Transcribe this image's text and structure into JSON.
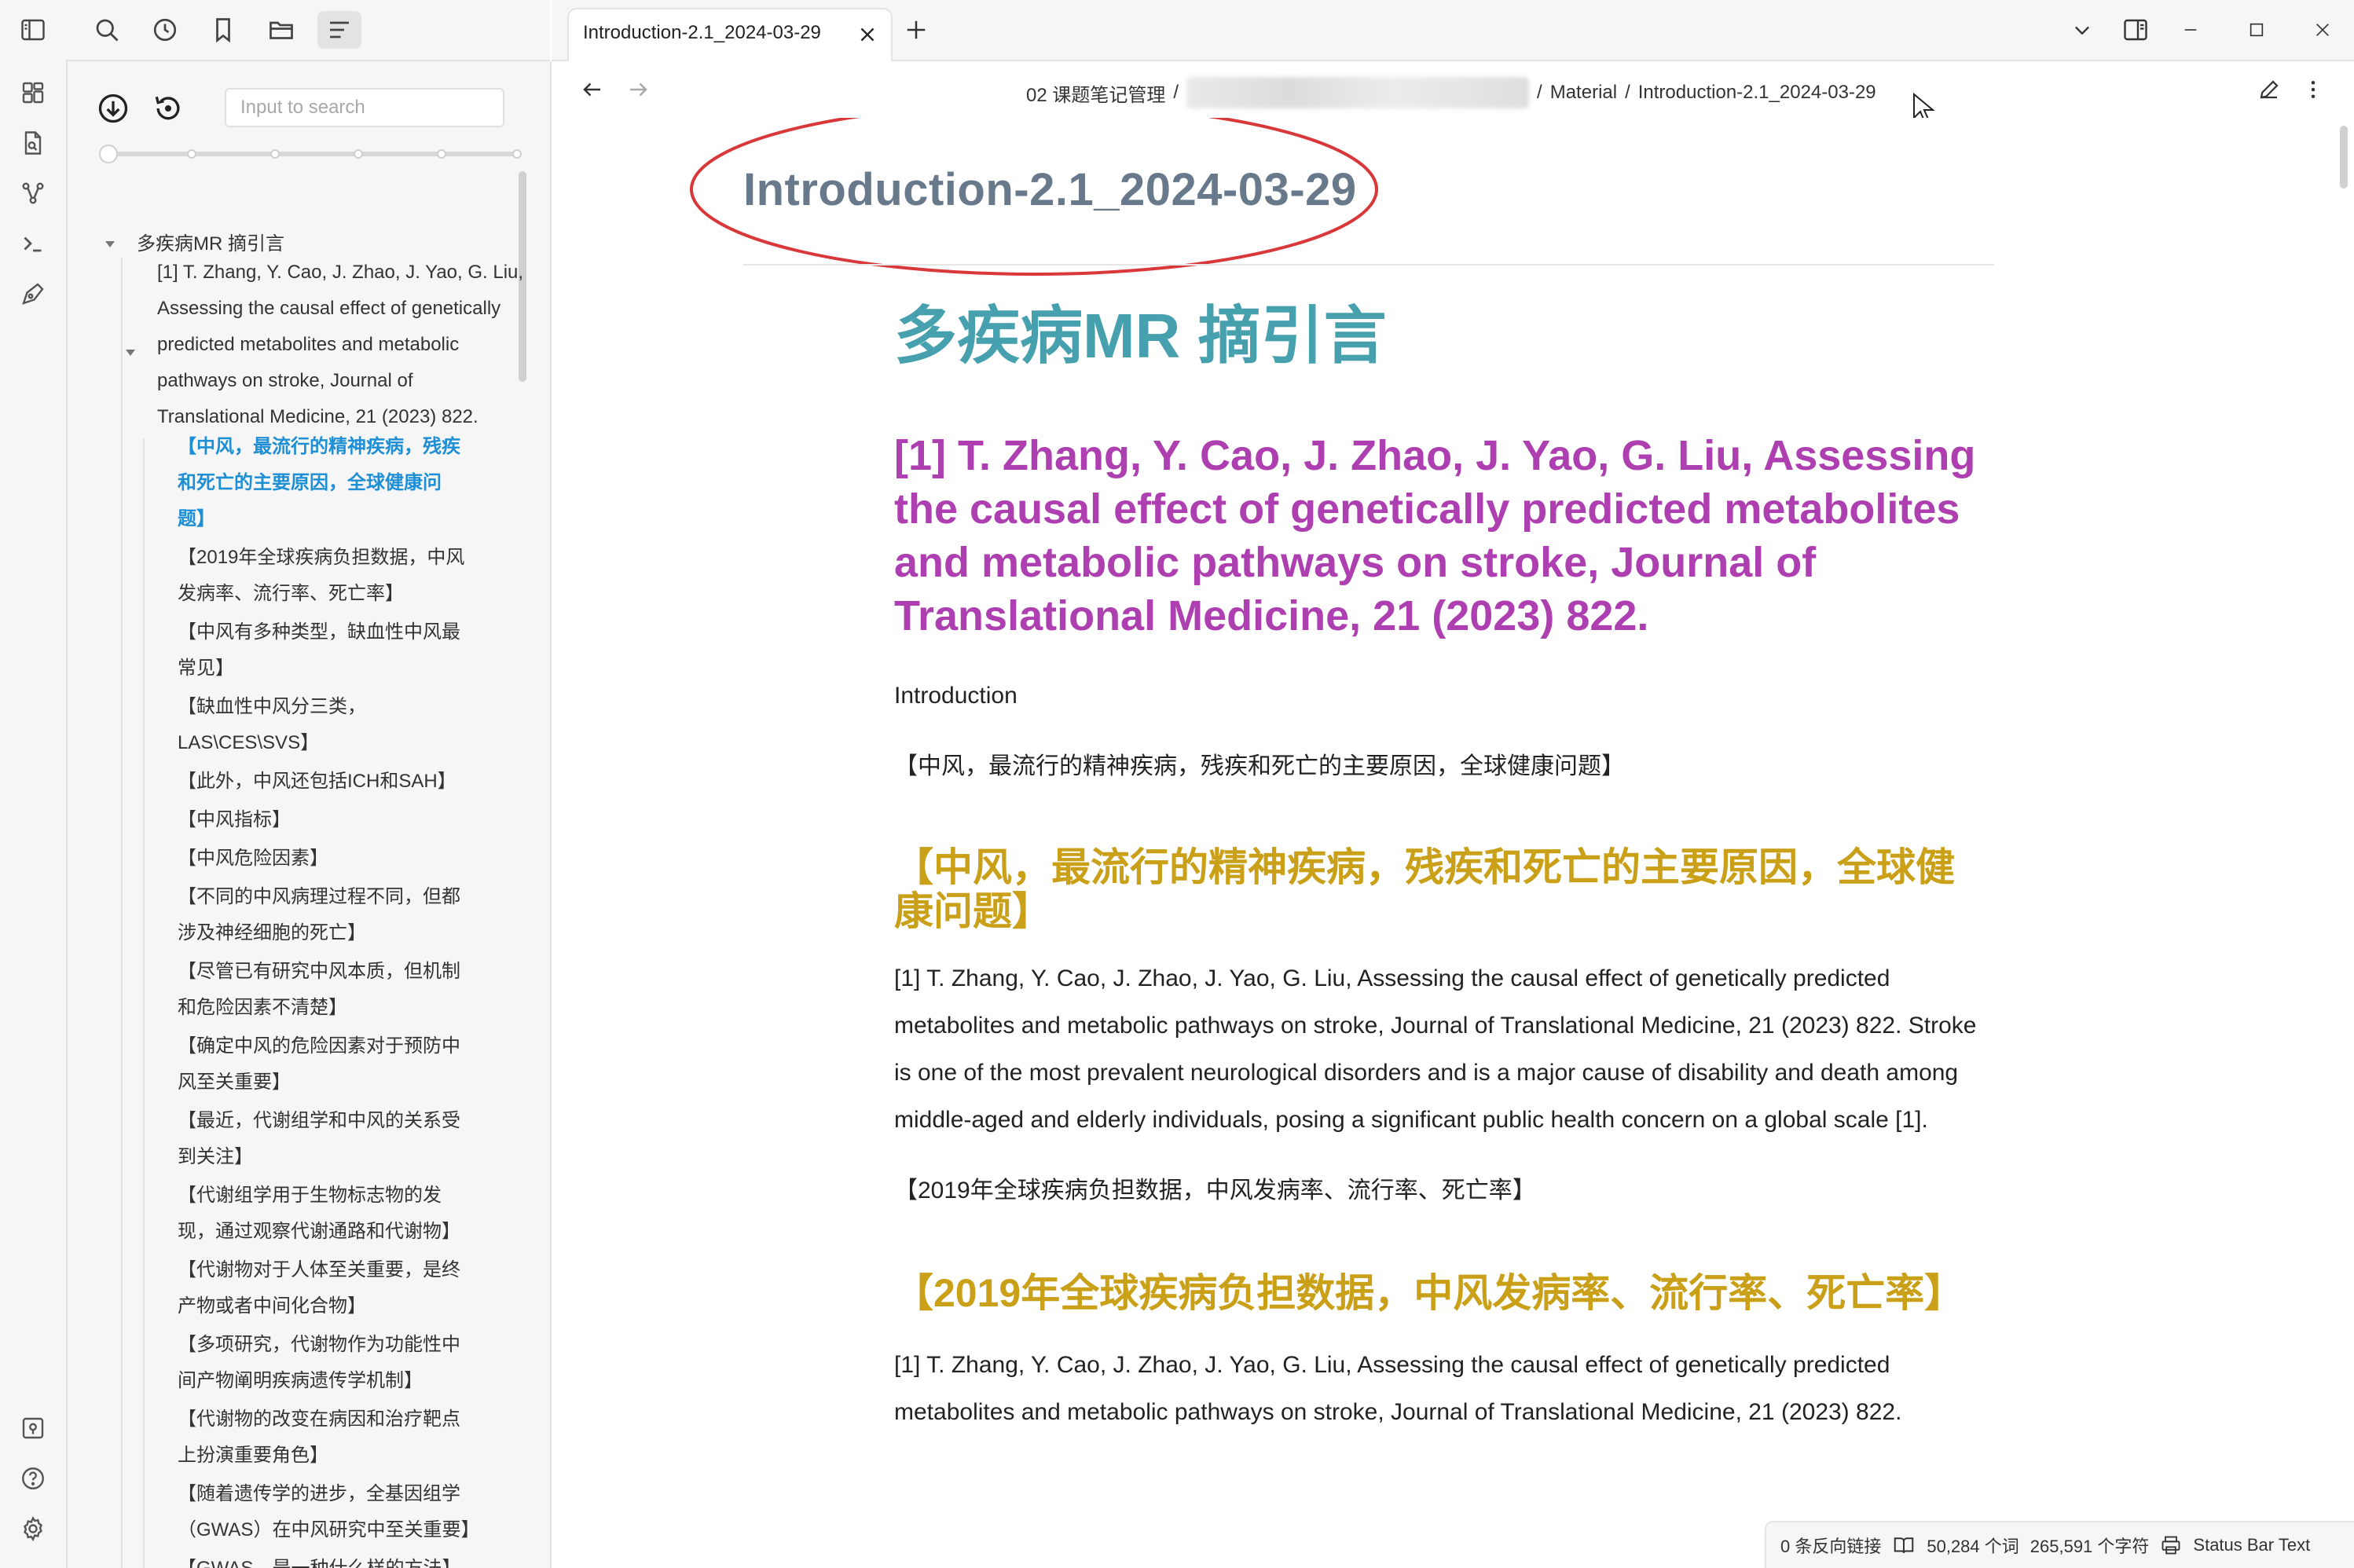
{
  "sidebar": {
    "search_placeholder": "Input to search",
    "outline": {
      "h1": "多疾病MR 摘引言",
      "h2": "[1] T. Zhang, Y. Cao, J. Zhao, J. Yao, G. Liu, Assessing the causal effect of genetically predicted metabolites and metabolic pathways on stroke, Journal of Translational Medicine, 21 (2023) 822.",
      "h2_lines": [
        "[1] T. Zhang, Y. Cao, J. Zhao, J. Yao, G. Liu,",
        "Assessing the causal effect of genetically",
        "predicted metabolites and metabolic",
        "pathways on stroke, Journal of",
        "Translational Medicine, 21 (2023) 822."
      ],
      "items": [
        [
          "【中风，最流行的精神疾病，残疾",
          "和死亡的主要原因，全球健康问",
          "题】"
        ],
        [
          "【2019年全球疾病负担数据，中风",
          "发病率、流行率、死亡率】"
        ],
        [
          "【中风有多种类型，缺血性中风最",
          "常见】"
        ],
        [
          "【缺血性中风分三类，",
          "LAS\\CES\\SVS】"
        ],
        [
          "【此外，中风还包括ICH和SAH】"
        ],
        [
          "【中风指标】"
        ],
        [
          "【中风危险因素】"
        ],
        [
          "【不同的中风病理过程不同，但都",
          "涉及神经细胞的死亡】"
        ],
        [
          "【尽管已有研究中风本质，但机制",
          "和危险因素不清楚】"
        ],
        [
          "【确定中风的危险因素对于预防中",
          "风至关重要】"
        ],
        [
          "【最近，代谢组学和中风的关系受",
          "到关注】"
        ],
        [
          "【代谢组学用于生物标志物的发",
          "现，通过观察代谢通路和代谢物】"
        ],
        [
          "【代谢物对于人体至关重要，是终",
          "产物或者中间化合物】"
        ],
        [
          "【多项研究，代谢物作为功能性中",
          "间产物阐明疾病遗传学机制】"
        ],
        [
          "【代谢物的改变在病因和治疗靶点",
          "上扮演重要角色】"
        ],
        [
          "【随着遗传学的进步，全基因组学",
          "（GWAS）在中风研究中至关重要】"
        ],
        [
          "【GWAS，是一种什么样的方法】"
        ]
      ]
    }
  },
  "tab": {
    "title": "Introduction-2.1_2024-03-29"
  },
  "breadcrumb": {
    "folder": "02 课题笔记管理",
    "sep": "/",
    "sub": "Material",
    "file": "Introduction-2.1_2024-03-29"
  },
  "doc": {
    "inline_title": "Introduction-2.1_2024-03-29",
    "h1": "多疾病MR 摘引言",
    "h2": "[1] T. Zhang, Y. Cao, J. Zhao, J. Yao, G. Liu, Assessing the causal effect of genetically predicted metabolites and metabolic pathways on stroke, Journal of Translational Medicine, 21 (2023) 822.",
    "intro_label": "Introduction",
    "bracket1": "【中风，最流行的精神疾病，残疾和死亡的主要原因，全球健康问题】",
    "h3_1": "【中风，最流行的精神疾病，残疾和死亡的主要原因，全球健康问题】",
    "para1": "[1] T. Zhang, Y. Cao, J. Zhao, J. Yao, G. Liu, Assessing the causal effect of genetically predicted metabolites and metabolic pathways on stroke, Journal of Translational Medicine, 21 (2023) 822. Stroke is one of the most prevalent neurological disorders and is a major cause of disability and death among middle-aged and elderly individuals, posing a significant public health concern on a global scale [1].",
    "bracket2": "【2019年全球疾病负担数据，中风发病率、流行率、死亡率】",
    "h3_2": "【2019年全球疾病负担数据，中风发病率、流行率、死亡率】",
    "para2": "[1] T. Zhang, Y. Cao, J. Zhao, J. Yao, G. Liu, Assessing the causal effect of genetically predicted metabolites and metabolic pathways on stroke, Journal of Translational Medicine, 21 (2023) 822."
  },
  "status": {
    "backlinks": "0 条反向链接",
    "words": "50,284 个词",
    "chars": "265,591 个字符",
    "custom": "Status Bar Text"
  },
  "colors": {
    "h1": "#46a0ae",
    "h2": "#ad3fb1",
    "h3": "#c9a018",
    "active_outline": "#1e8fd4",
    "annotation": "#d9383b"
  }
}
